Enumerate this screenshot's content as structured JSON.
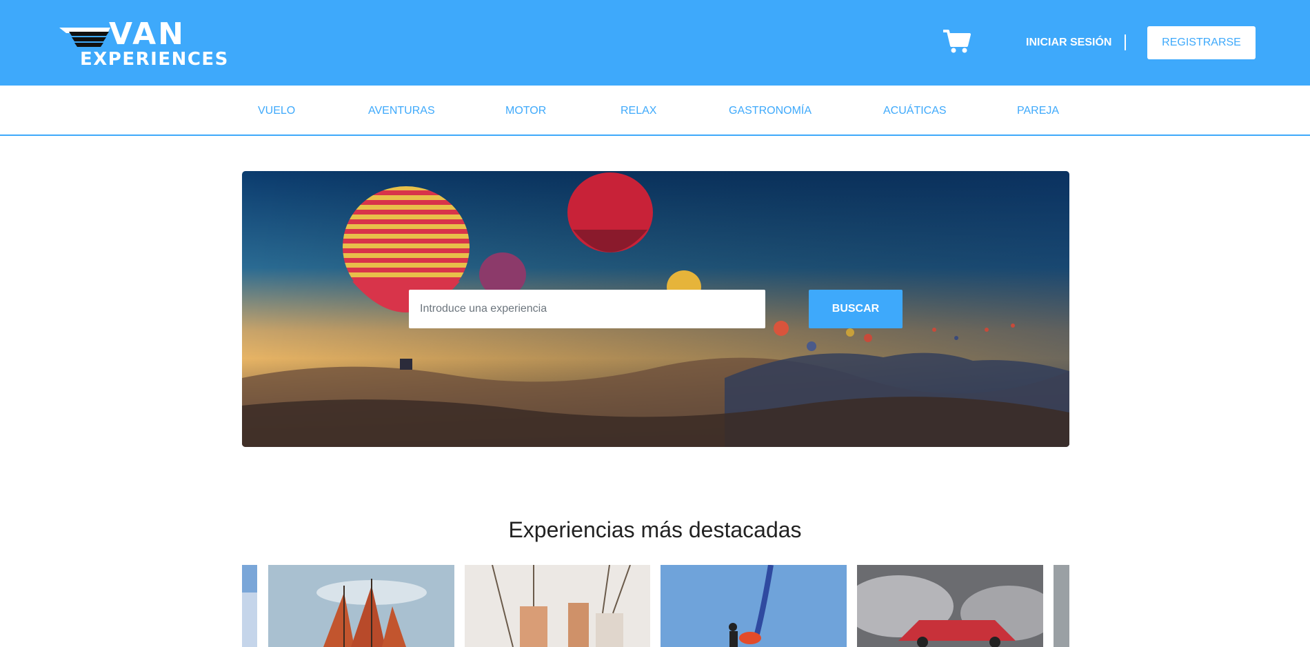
{
  "brand": {
    "line1": "VAN",
    "line2": "EXPERIENCES"
  },
  "header": {
    "cart_icon": "cart-icon",
    "login_label": "INICIAR SESIÓN",
    "register_label": "REGISTRARSE",
    "accent_color": "#3ea9fb"
  },
  "categories": [
    "VUELO",
    "AVENTURAS",
    "MOTOR",
    "RELAX",
    "GASTRONOMÍA",
    "ACUÁTICAS",
    "PAREJA"
  ],
  "search": {
    "placeholder": "Introduce una experiencia",
    "value": "",
    "button_label": "BUSCAR"
  },
  "featured": {
    "title": "Experiencias más destacadas"
  }
}
